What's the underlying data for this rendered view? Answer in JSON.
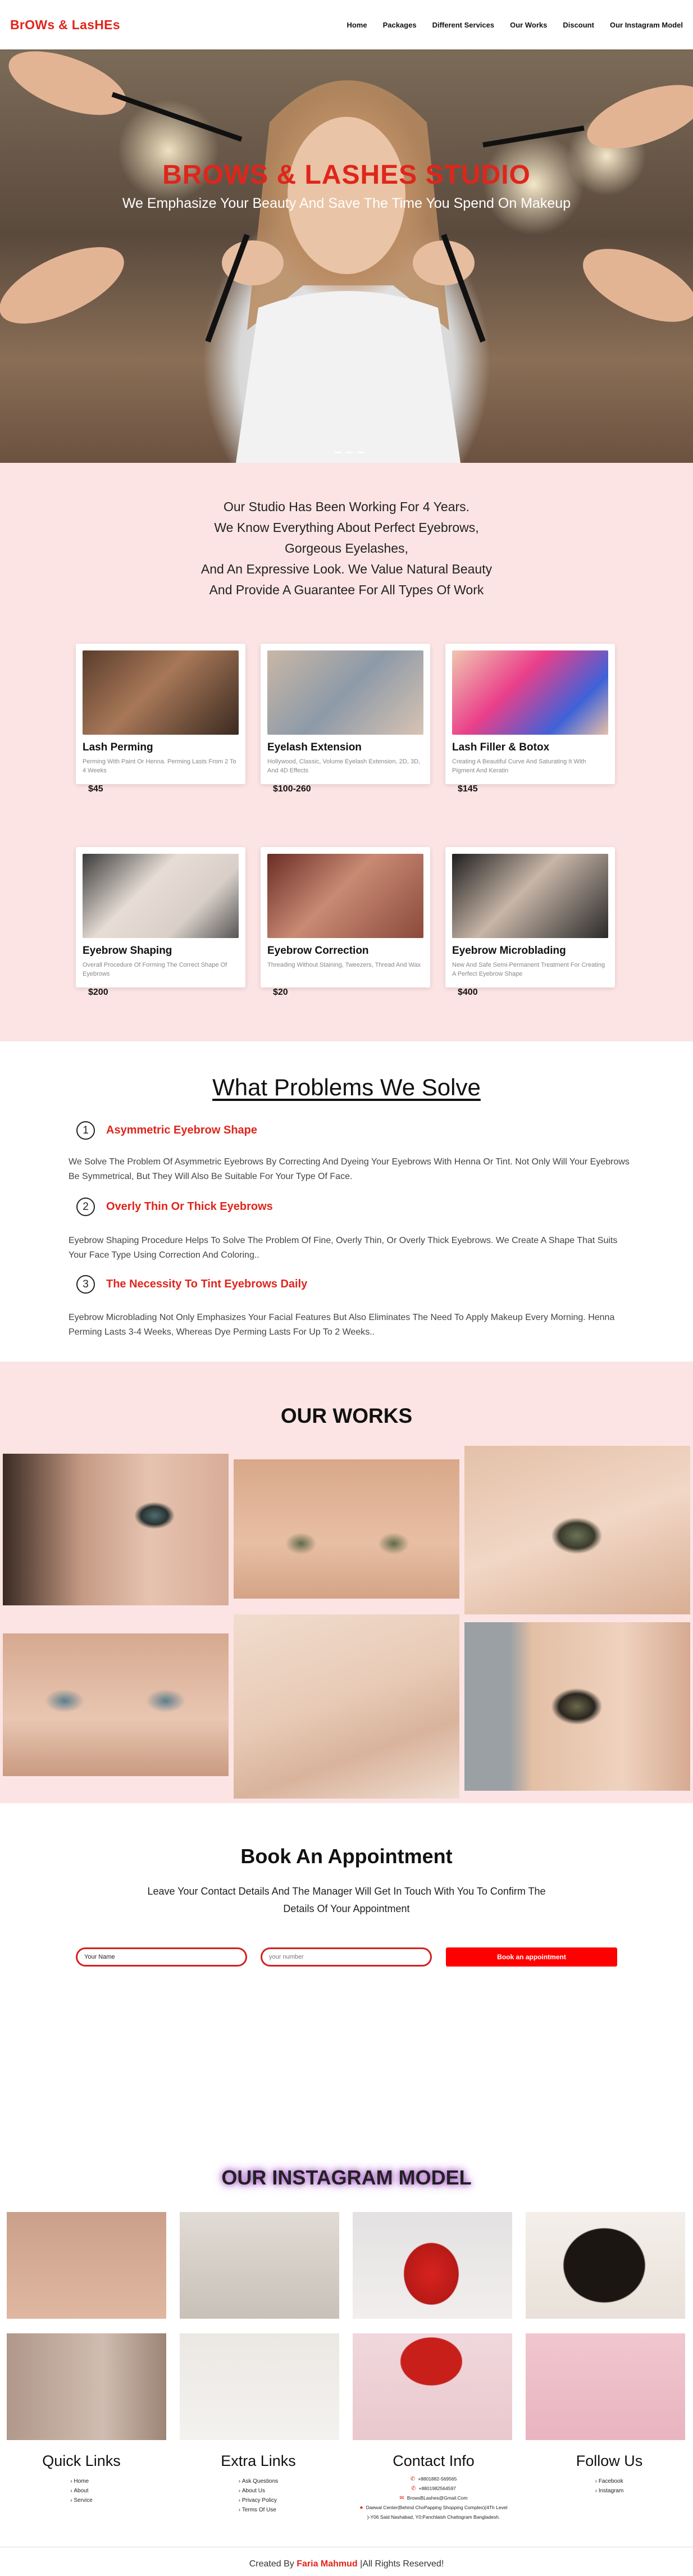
{
  "nav": {
    "brand": "BrOWs & LasHEs",
    "items": [
      "Home",
      "Packages",
      "Different Services",
      "Our Works",
      "Discount",
      "Our Instagram Model"
    ]
  },
  "hero": {
    "title": "BROWS & LASHES STUDIO",
    "subtitle": "We Emphasize Your Beauty And Save The Time You Spend On Makeup"
  },
  "intro": {
    "lines": [
      "Our Studio Has Been Working For 4 Years.",
      "We Know Everything About Perfect Eyebrows,",
      "Gorgeous Eyelashes,",
      "And An Expressive Look. We Value Natural Beauty",
      "And Provide A Guarantee For All Types Of Work"
    ]
  },
  "services": [
    {
      "title": "Lash Perming",
      "desc": "Perming With Paint Or Henna. Perming Lasts From 2 To 4 Weeks",
      "price": "$45"
    },
    {
      "title": "Eyelash Extension",
      "desc": "Hollywood, Classic, Volume Eyelash Extension, 2D, 3D, And 4D Effects",
      "price": "$100-260"
    },
    {
      "title": "Lash Filler & Botox",
      "desc": "Creating A Beautiful Curve And Saturating It With Pigment And Keratin",
      "price": "$145"
    },
    {
      "title": "Eyebrow Shaping",
      "desc": "Overall Procedure Of Forming The Correct Shape Of Eyebrows",
      "price": "$200"
    },
    {
      "title": "Eyebrow Correction",
      "desc": "Threading Without Staining, Tweezers, Thread And Wax",
      "price": "$20"
    },
    {
      "title": "Eyebrow Microblading",
      "desc": "New And Safe Semi-Permanent Treatment For Creating A Perfect Eyebrow Shape",
      "price": "$400"
    }
  ],
  "problems": {
    "title": "What Problems We Solve",
    "items": [
      {
        "num": "1",
        "heading": "Asymmetric Eyebrow Shape",
        "text": "We Solve The Problem Of Asymmetric Eyebrows By Correcting And Dyeing Your Eyebrows With Henna Or Tint. Not Only Will Your Eyebrows Be Symmetrical, But They Will Also Be Suitable For Your Type Of Face."
      },
      {
        "num": "2",
        "heading": "Overly Thin Or Thick Eyebrows",
        "text": "Eyebrow Shaping Procedure Helps To Solve The Problem Of Fine, Overly Thin, Or Overly Thick Eyebrows. We Create A Shape That Suits Your Face Type Using Correction And Coloring.."
      },
      {
        "num": "3",
        "heading": "The Necessity To Tint Eyebrows Daily",
        "text": "Eyebrow Microblading Not Only Emphasizes Your Facial Features But Also Eliminates The Need To Apply Makeup Every Morning. Henna Perming Lasts 3-4 Weeks, Whereas Dye Perming Lasts For Up To 2 Weeks.."
      }
    ]
  },
  "works": {
    "title": "OUR WORKS"
  },
  "booking": {
    "title": "Book An Appointment",
    "subtitle": "Leave Your Contact Details And The Manager Will Get In Touch With You To Confirm The Details Of Your Appointment",
    "name_value": "Your Name",
    "phone_placeholder": "your number",
    "button": "Book an appointment"
  },
  "instagram": {
    "title": "OUR INSTAGRAM MODEL"
  },
  "footer": {
    "quick_links": {
      "title": "Quick Links",
      "items": [
        "Home",
        "About",
        "Service"
      ]
    },
    "extra_links": {
      "title": "Extra Links",
      "items": [
        "Ask Questions",
        "About Us",
        "Privacy Policy",
        "Terms Of Use"
      ]
    },
    "contact": {
      "title": "Contact Info",
      "phone1": "+8801882-569565",
      "phone2": "+8801982564597",
      "email": "BrowsBLashes@Gmail.Com",
      "address_line1": "Daewal Center(Behind ChoPapping Shopping Complex)(4Th Level",
      "address_line2": ")-Y06 Said Nashabad, Y0;Panchlaish Chattogram Bangladesh."
    },
    "follow": {
      "title": "Follow Us",
      "items": [
        "Facebook",
        "Instagram"
      ]
    },
    "copyright_prefix": "Created By",
    "copyright_name": "Faria Mahmud",
    "copyright_suffix": "|All Rights Reserved!"
  }
}
